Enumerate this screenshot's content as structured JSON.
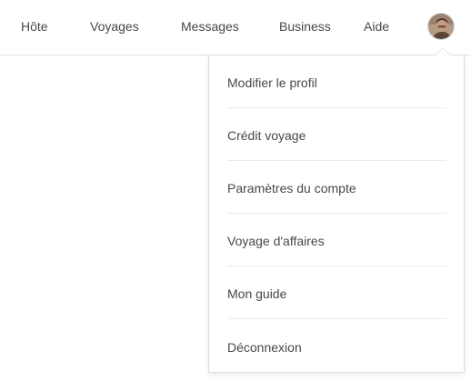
{
  "nav": {
    "items": [
      "Hôte",
      "Voyages",
      "Messages",
      "Business",
      "Aide"
    ]
  },
  "avatar": {
    "icon": "user-avatar-photo"
  },
  "dropdown": {
    "items": [
      "Modifier le profil",
      "Crédit voyage",
      "Paramètres du compte",
      "Voyage d'affaires",
      "Mon guide",
      "Déconnexion"
    ]
  }
}
